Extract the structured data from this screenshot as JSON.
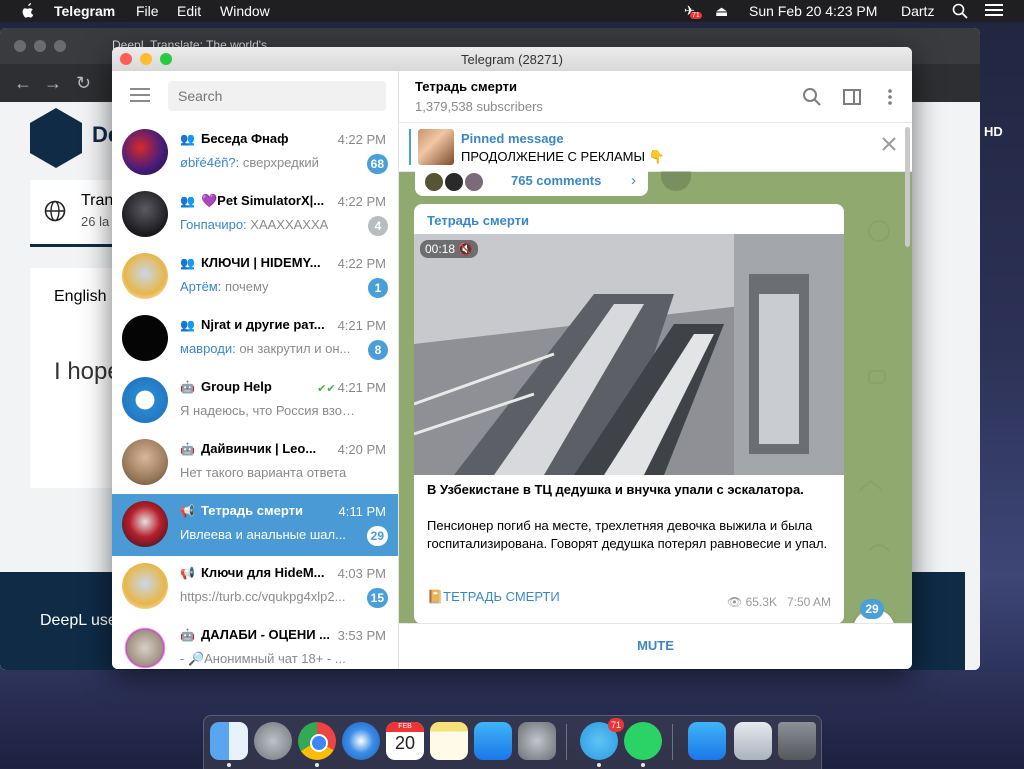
{
  "menubar": {
    "app": "Telegram",
    "items": [
      "File",
      "Edit",
      "Window"
    ],
    "notif_badge": "71",
    "datetime": "Sun Feb 20  4:23 PM",
    "user": "Dartz"
  },
  "browser": {
    "tab_title": "DeepL Translate: The world's ...",
    "logo_text": "De",
    "card_title": "Tran",
    "card_sub": "26 la",
    "lang": "English",
    "input_text": "I hope",
    "footer_text": "DeepL use",
    "side_text": "HD"
  },
  "telegram": {
    "window_title": "Telegram (28271)",
    "search_placeholder": "Search",
    "chats": [
      {
        "type": "group",
        "name": "Беседа Фнаф",
        "time": "4:22 PM",
        "sender": "øbřé4ěñ?:",
        "preview": " сверхредкий",
        "badge": "68",
        "muted": false
      },
      {
        "type": "group",
        "name": "💜Pet SimulatorX|...",
        "time": "4:22 PM",
        "sender": "Гонпачиро:",
        "preview": " ХААХХАХХА",
        "badge": "4",
        "muted": true
      },
      {
        "type": "group",
        "name": "КЛЮЧИ | HIDEMY...",
        "time": "4:22 PM",
        "sender": "Артём:",
        "preview": " почему",
        "badge": "1",
        "muted": false
      },
      {
        "type": "group",
        "name": "Njrat и другие рат...",
        "time": "4:21 PM",
        "sender": "мавроди:",
        "preview": " он закрутил и он...",
        "badge": "8",
        "muted": false
      },
      {
        "type": "bot",
        "name": "Group Help",
        "time": "4:21 PM",
        "sender": "",
        "preview": "Я надеюсь, что Россия взорвет...",
        "badge": "",
        "muted": false
      },
      {
        "type": "bot",
        "name": "Дайвинчик | Leo...",
        "time": "4:20 PM",
        "sender": "",
        "preview": "Нет такого варианта ответа",
        "badge": "",
        "muted": false
      },
      {
        "type": "channel",
        "name": "Тетрадь смерти",
        "time": "4:11 PM",
        "sender": "",
        "preview": "Ивлеева и анальные шал...",
        "badge": "29",
        "muted": false
      },
      {
        "type": "channel",
        "name": "Ключи для HideM...",
        "time": "4:03 PM",
        "sender": "",
        "preview": "https://turb.cc/vqukpg4xlp2...",
        "badge": "15",
        "muted": false
      },
      {
        "type": "bot",
        "name": "ДАЛАБИ - ОЦЕНИ ...",
        "time": "3:53 PM",
        "sender": "",
        "preview": "- 🔎Анонимный чат 18+ - ...",
        "badge": "",
        "muted": false
      }
    ],
    "channel": {
      "name": "Тетрадь смерти",
      "subscribers": "1,379,538 subscribers",
      "pinned_title": "Pinned message",
      "pinned_text": "ПРОДОЛЖЕНИЕ С РЕКЛАМЫ 👇",
      "comments": "765 comments",
      "post": {
        "channel": "Тетрадь смерти",
        "video_time": "00:18",
        "headline": "В Узбекистане в ТЦ дедушка и внучка упали с эскалатора.",
        "body": "Пенсионер погиб на месте, трехлетняя девочка выжила и была госпитализирована. Говорят дедушка потерял равновесие и упал.",
        "link": "📔ТЕТРАДЬ СМЕРТИ",
        "views": "65.3K",
        "time": "7:50 AM"
      },
      "unread": "29",
      "mute_label": "MUTE"
    }
  },
  "dock": {
    "calendar_month": "FEB",
    "calendar_day": "20",
    "telegram_badge": "71"
  },
  "colors": {
    "accent": "#4a9fd8",
    "active_chat": "#4a9ad6",
    "chat_bg": "#8fa96e"
  }
}
